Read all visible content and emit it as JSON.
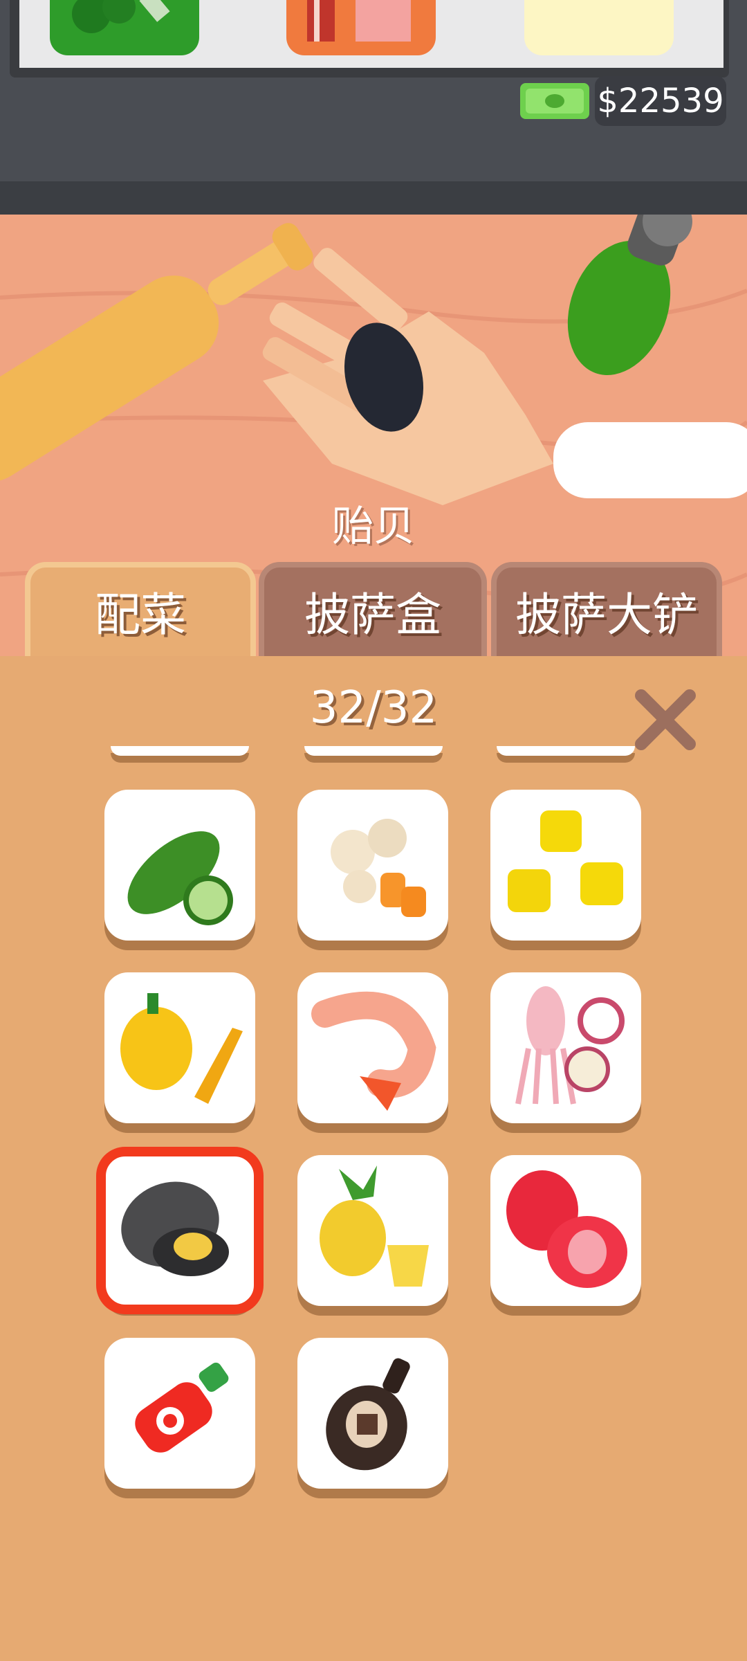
{
  "hud": {
    "money": "$22539",
    "money_icon": "cash-icon"
  },
  "scene": {
    "ingredient_name": "贻贝"
  },
  "tabs": [
    {
      "label": "配菜",
      "active": true
    },
    {
      "label": "披萨盒",
      "active": false
    },
    {
      "label": "披萨大铲",
      "active": false
    }
  ],
  "panel": {
    "count": "32/32",
    "close_icon": "close-icon"
  },
  "ingredients": [
    {
      "name": "zucchini-icon"
    },
    {
      "name": "mushroom-carrot-icon"
    },
    {
      "name": "corn-icon"
    },
    {
      "name": "bell-pepper-icon"
    },
    {
      "name": "shrimp-icon"
    },
    {
      "name": "squid-onion-icon"
    },
    {
      "name": "mussel-icon",
      "selected": true
    },
    {
      "name": "pineapple-icon"
    },
    {
      "name": "strawberry-icon"
    },
    {
      "name": "hot-sauce-icon"
    },
    {
      "name": "chocolate-syrup-icon"
    }
  ],
  "colors": {
    "selection": "#f23a1d",
    "panel": "#e6aa72",
    "tab_inactive": "#a47160"
  }
}
